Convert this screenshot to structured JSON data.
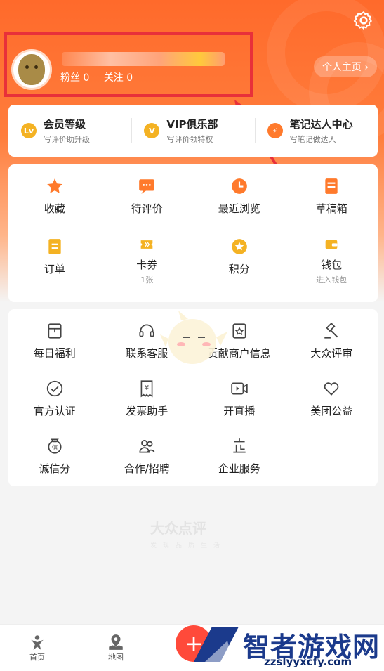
{
  "profile": {
    "fans_label": "粉丝 0",
    "follow_label": "关注 0",
    "homepage_label": "个人主页 ›"
  },
  "vip": [
    {
      "title": "会员等级",
      "sub": "写评价助升级",
      "icon": "Lv"
    },
    {
      "title": "VIP俱乐部",
      "sub": "写评价领特权",
      "icon": "V"
    },
    {
      "title": "笔记达人中心",
      "sub": "写笔记做达人",
      "icon": "⚡"
    }
  ],
  "grid1": [
    {
      "label": "收藏",
      "sub": ""
    },
    {
      "label": "待评价",
      "sub": ""
    },
    {
      "label": "最近浏览",
      "sub": ""
    },
    {
      "label": "草稿箱",
      "sub": ""
    },
    {
      "label": "订单",
      "sub": ""
    },
    {
      "label": "卡券",
      "sub": "1张"
    },
    {
      "label": "积分",
      "sub": ""
    },
    {
      "label": "钱包",
      "sub": "进入钱包"
    }
  ],
  "grid2": [
    {
      "label": "每日福利"
    },
    {
      "label": "联系客服"
    },
    {
      "label": "贡献商户信息"
    },
    {
      "label": "大众评审"
    },
    {
      "label": "官方认证"
    },
    {
      "label": "发票助手"
    },
    {
      "label": "开直播"
    },
    {
      "label": "美团公益"
    },
    {
      "label": "诚信分"
    },
    {
      "label": "合作/招聘"
    },
    {
      "label": "企业服务"
    }
  ],
  "brand": {
    "name": "大众点评",
    "slogan": "发现品质生活"
  },
  "tabs": [
    {
      "label": "首页"
    },
    {
      "label": "地图"
    }
  ],
  "watermark": {
    "text": "智者游戏网",
    "url": "zzslyyxcfy.com"
  },
  "colors": {
    "accent": "#ff6a2b",
    "highlight_box": "#e8303a",
    "icon_orange": "#ff7a2c",
    "icon_gold": "#f4b223"
  }
}
